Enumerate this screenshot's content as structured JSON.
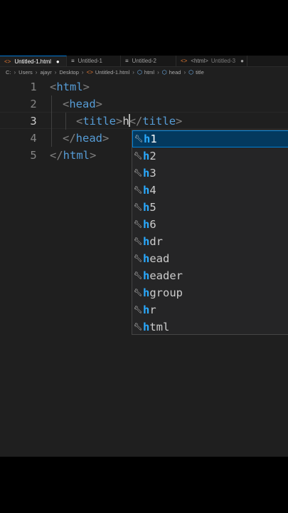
{
  "tabs": [
    {
      "label": "Untitled-1.html",
      "icon": "html-file-icon",
      "active": true,
      "dirty": true
    },
    {
      "label": "Untitled-1",
      "icon": "text-file-icon",
      "active": false
    },
    {
      "label": "Untitled-2",
      "icon": "text-file-icon",
      "active": false
    },
    {
      "label": "<html>",
      "sublabel": "Untitled-3",
      "icon": "html-file-icon",
      "active": false,
      "dirty": true
    }
  ],
  "breadcrumb": [
    "C:",
    "Users",
    "ajayr",
    "Desktop",
    "Untitled-1.html",
    "html",
    "head",
    "title"
  ],
  "editor": {
    "line_numbers": [
      "1",
      "2",
      "3",
      "4",
      "5"
    ],
    "current_line": 3,
    "lines": [
      {
        "open": "<",
        "tag": "html",
        "close": ">"
      },
      {
        "open": "<",
        "tag": "head",
        "close": ">"
      },
      {
        "open": "<",
        "tag": "title",
        "close": ">",
        "text": "h",
        "open2": "</",
        "tag2": "title",
        "close2": ">"
      },
      {
        "open": "</",
        "tag": "head",
        "close": ">"
      },
      {
        "open": "</",
        "tag": "html",
        "close": ">"
      }
    ]
  },
  "suggest": {
    "match": "h",
    "items": [
      {
        "rest": "1"
      },
      {
        "rest": "2"
      },
      {
        "rest": "3"
      },
      {
        "rest": "4"
      },
      {
        "rest": "5"
      },
      {
        "rest": "6"
      },
      {
        "rest": "dr"
      },
      {
        "rest": "ead"
      },
      {
        "rest": "eader"
      },
      {
        "rest": "group"
      },
      {
        "rest": "r"
      },
      {
        "rest": "tml"
      }
    ],
    "selected_index": 0,
    "item_icon": "wrench-icon"
  },
  "colors": {
    "tag": "#569cd6",
    "bracket": "#808080",
    "match": "#2aaaff",
    "selection": "#04395e"
  }
}
